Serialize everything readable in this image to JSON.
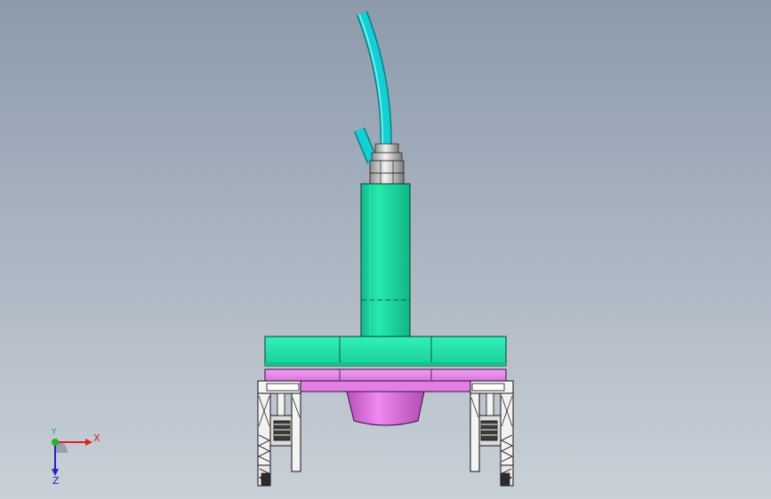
{
  "viewport": {
    "background_top": "#8c9aab",
    "background_bottom": "#c9d0d8"
  },
  "model": {
    "parts": [
      {
        "name": "air-hose",
        "color": "#00c2c9"
      },
      {
        "name": "hose-fitting",
        "color": "#d8d8d8"
      },
      {
        "name": "cylinder-body",
        "color": "#1ee3a7"
      },
      {
        "name": "mounting-flange",
        "color": "#26e6b0"
      },
      {
        "name": "adapter-plate",
        "color": "#e98aea"
      },
      {
        "name": "suction-cup",
        "color": "#e475e6"
      },
      {
        "name": "gripper-jaw-left",
        "color": "#ffffff"
      },
      {
        "name": "gripper-jaw-right",
        "color": "#ffffff"
      }
    ]
  },
  "triad": {
    "x_label": "X",
    "y_label": "Y",
    "z_label": "Z",
    "x_color": "#e0201c",
    "y_color": "#22b422",
    "z_color": "#2323c8",
    "icon": "coordinate-triad-icon"
  }
}
